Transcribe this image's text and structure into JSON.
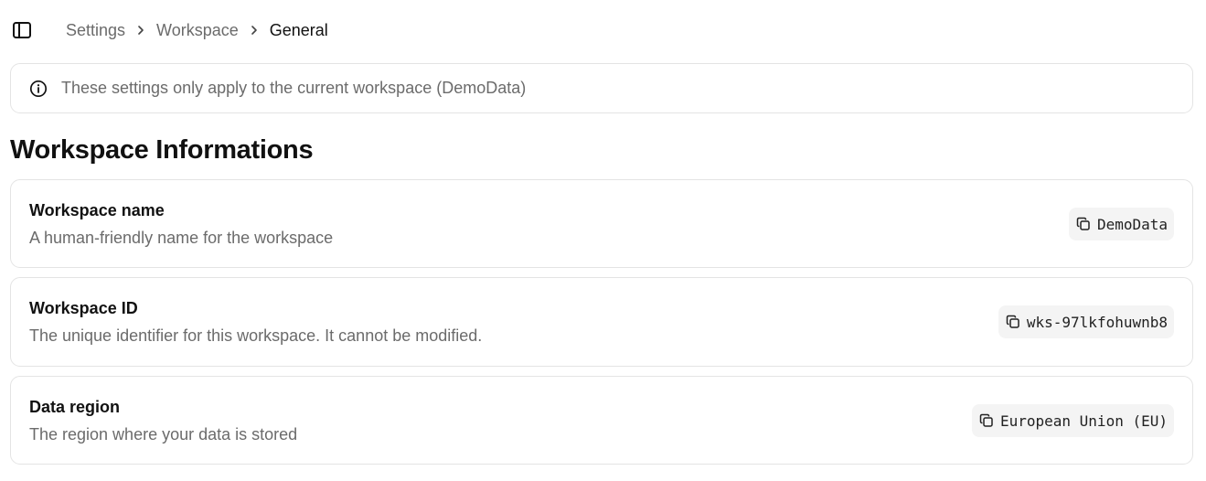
{
  "breadcrumb": {
    "items": [
      "Settings",
      "Workspace",
      "General"
    ]
  },
  "banner": {
    "text": "These settings only apply to the current workspace (DemoData)"
  },
  "section": {
    "title": "Workspace Informations"
  },
  "settings": [
    {
      "title": "Workspace name",
      "description": "A human-friendly name for the workspace",
      "value": "DemoData"
    },
    {
      "title": "Workspace ID",
      "description": "The unique identifier for this workspace. It cannot be modified.",
      "value": "wks-97lkfohuwnb8"
    },
    {
      "title": "Data region",
      "description": "The region where your data is stored",
      "value": "European Union (EU)"
    }
  ],
  "colors": {
    "text_primary": "#111111",
    "text_muted": "#6b6b6b",
    "border": "#e4e4e4",
    "pill_bg": "#f4f4f4"
  },
  "icons": {
    "sidebar_toggle": "sidebar-toggle-icon",
    "breadcrumb_separator": "chevron-right-icon",
    "banner": "info-icon",
    "copy": "copy-icon"
  }
}
